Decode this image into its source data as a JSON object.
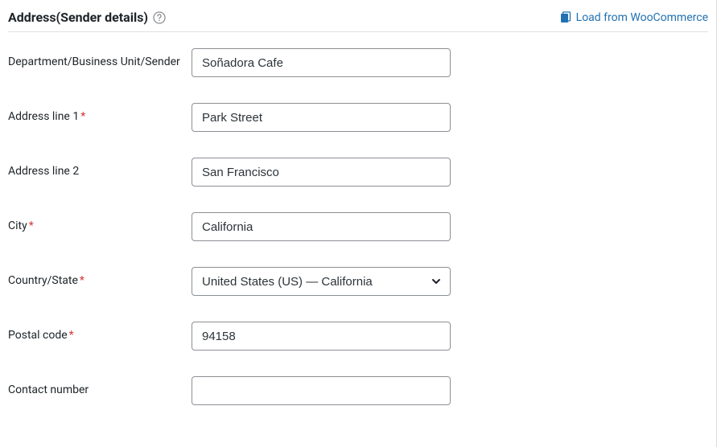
{
  "header": {
    "title": "Address(Sender details)",
    "load_link": "Load from WooCommerce"
  },
  "fields": {
    "department": {
      "label": "Department/Business Unit/Sender",
      "value": "Soñadora Cafe",
      "required": false
    },
    "address1": {
      "label": "Address line 1",
      "value": "Park Street",
      "required": true
    },
    "address2": {
      "label": "Address line 2",
      "value": "San Francisco",
      "required": false
    },
    "city": {
      "label": "City",
      "value": "California",
      "required": true
    },
    "country_state": {
      "label": "Country/State",
      "value": "United States (US) — California",
      "required": true
    },
    "postal": {
      "label": "Postal code",
      "value": "94158",
      "required": true
    },
    "contact": {
      "label": "Contact number",
      "value": "",
      "required": false
    }
  }
}
